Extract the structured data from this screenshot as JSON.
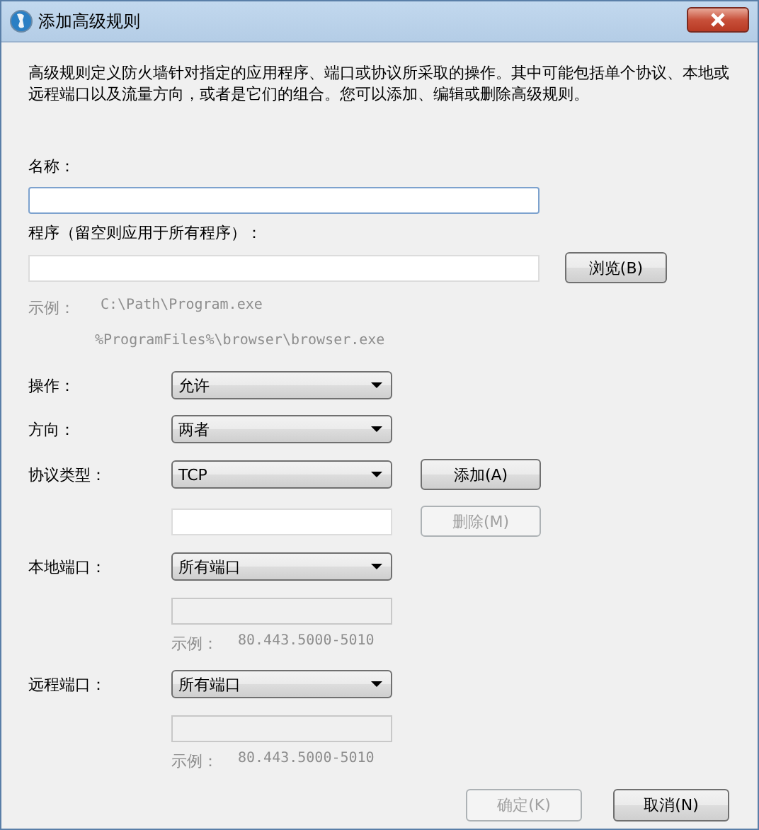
{
  "window": {
    "title": "添加高级规则"
  },
  "description": "高级规则定义防火墙针对指定的应用程序、端口或协议所采取的操作。其中可能包括单个协议、本地或远程端口以及流量方向，或者是它们的组合。您可以添加、编辑或删除高级规则。",
  "name_field": {
    "label": "名称："
  },
  "program_field": {
    "label": "程序（留空则应用于所有程序）：",
    "browse_button": "浏览(B)",
    "example_label": "示例：",
    "examples": [
      "C:\\Path\\Program.exe",
      "%ProgramFiles%\\browser\\browser.exe"
    ]
  },
  "action": {
    "label": "操作：",
    "value": "允许"
  },
  "direction": {
    "label": "方向：",
    "value": "两者"
  },
  "protocol": {
    "label": "协议类型：",
    "value": "TCP",
    "add_button": {
      "label": "添加(A)",
      "disabled": false
    },
    "remove_button": {
      "label": "删除(M)",
      "disabled": true
    }
  },
  "ports": [
    {
      "label": "本地端口：",
      "value": "所有端口",
      "field_disabled": true,
      "example_label": "示例：",
      "example": "80.443.5000-5010"
    },
    {
      "label": "远程端口：",
      "value": "所有端口",
      "field_disabled": true,
      "example_label": "示例：",
      "example": "80.443.5000-5010"
    }
  ],
  "buttons": [
    {
      "label": "确定(K)",
      "disabled": true
    },
    {
      "label": "取消(N)",
      "disabled": false
    }
  ]
}
